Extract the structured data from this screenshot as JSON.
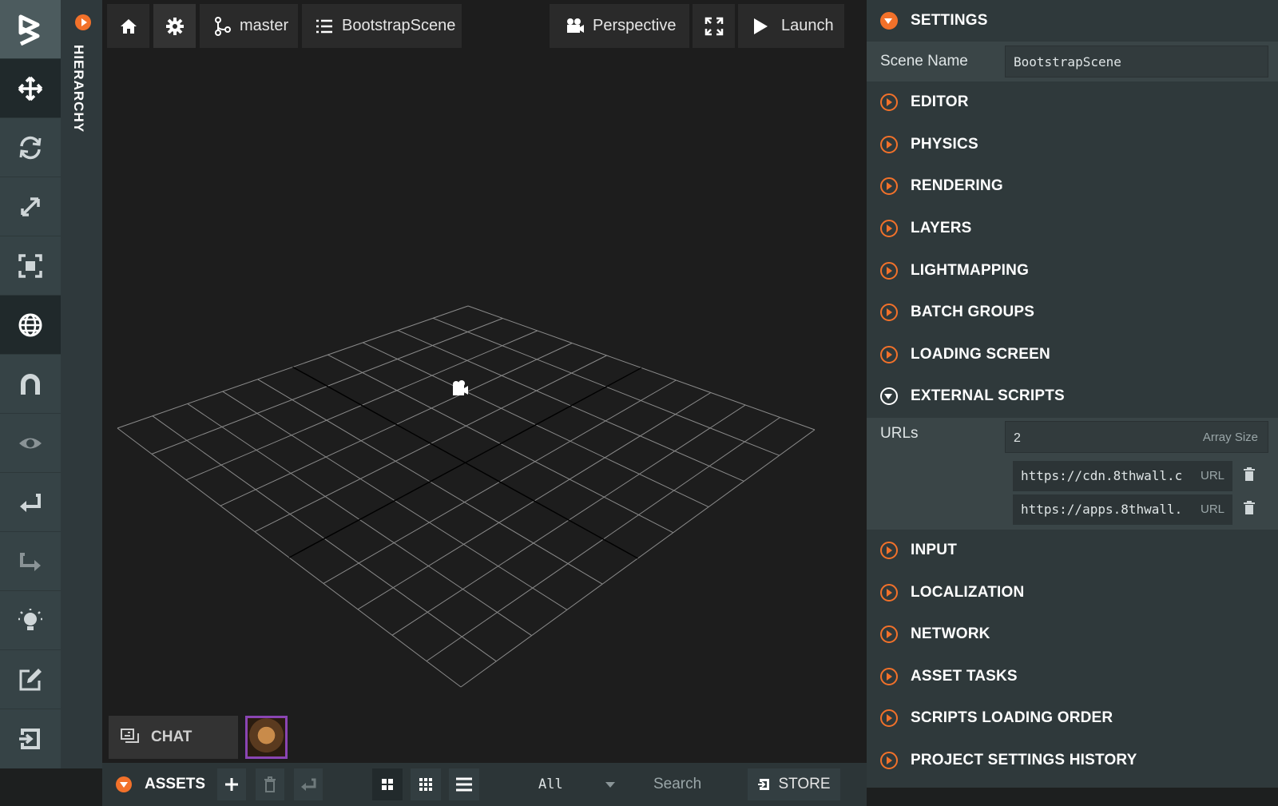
{
  "hierarchy": {
    "label": "HIERARCHY"
  },
  "toolbar": {
    "tools": [
      "logo-icon",
      "translate-icon",
      "rotate-icon",
      "scale-icon",
      "resize-icon",
      "world-icon",
      "magnet-icon",
      "eye-icon",
      "undo-icon",
      "redo-icon",
      "light-icon",
      "edit-icon",
      "publish-icon"
    ]
  },
  "topbar": {
    "branch": "master",
    "scene": "BootstrapScene",
    "camera": "Perspective",
    "launch": "Launch"
  },
  "chat": {
    "label": "CHAT"
  },
  "assets": {
    "label": "ASSETS",
    "filter": "All",
    "search_placeholder": "Search",
    "store": "STORE"
  },
  "settings": {
    "title": "SETTINGS",
    "scene_name_label": "Scene Name",
    "scene_name_value": "BootstrapScene",
    "sections_before": [
      "EDITOR",
      "PHYSICS",
      "RENDERING",
      "LAYERS",
      "LIGHTMAPPING",
      "BATCH GROUPS",
      "LOADING SCREEN"
    ],
    "external_scripts": {
      "title": "EXTERNAL SCRIPTS",
      "urls_label": "URLs",
      "array_size": "2",
      "array_size_label": "Array Size",
      "url_tag": "URL",
      "urls": [
        "https://cdn.8thwall.c",
        "https://apps.8thwall."
      ]
    },
    "sections_after": [
      "INPUT",
      "LOCALIZATION",
      "NETWORK",
      "ASSET TASKS",
      "SCRIPTS LOADING ORDER",
      "PROJECT SETTINGS HISTORY"
    ]
  },
  "colors": {
    "accent": "#f2712a",
    "panel": "#2f393b",
    "viewport": "#1d1d1d",
    "avatar_border": "#8a45b3"
  }
}
